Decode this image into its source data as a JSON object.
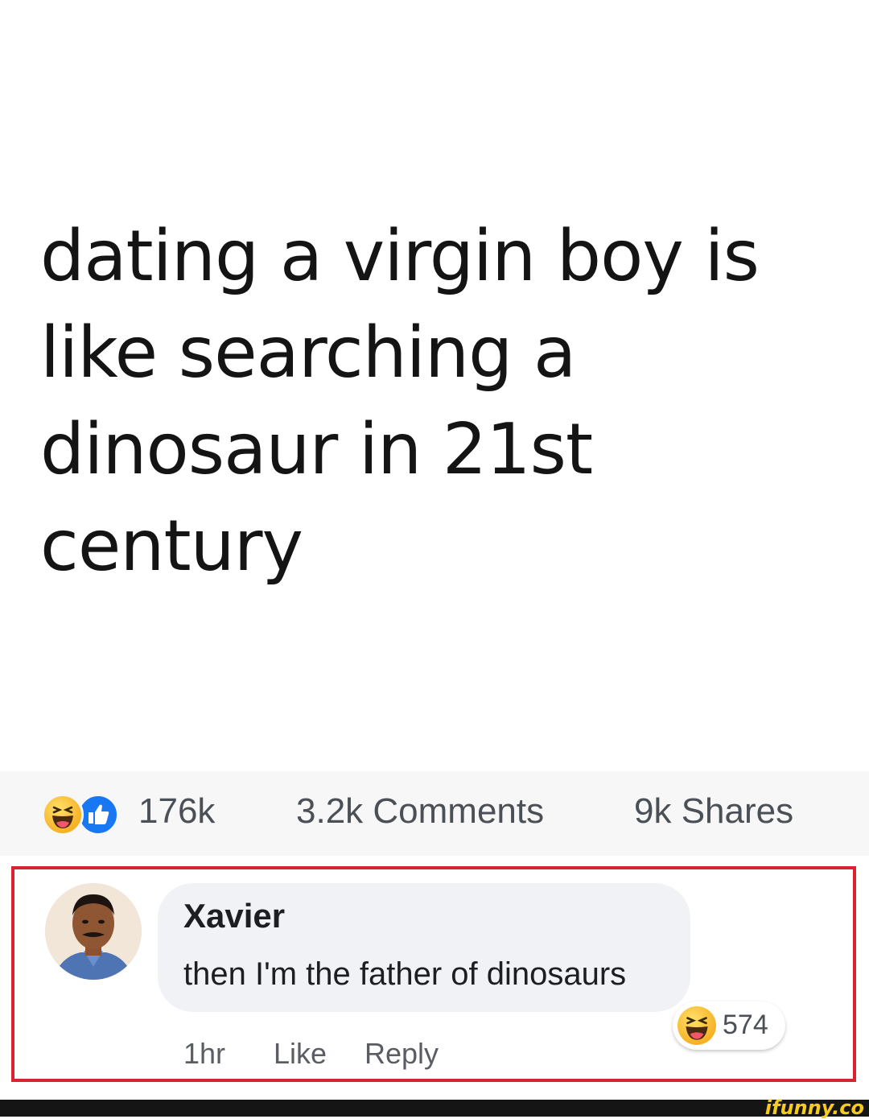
{
  "post": {
    "text": "dating a virgin boy is like searching a dinosaur in 21st century"
  },
  "stats": {
    "reaction_icons": [
      "haha-icon",
      "like-icon"
    ],
    "reactions_count": "176k",
    "comments_label": "3.2k Comments",
    "shares_label": "9k Shares"
  },
  "comment": {
    "author": "Xavier",
    "text": "then I'm the father of dinosaurs",
    "time": "1hr",
    "like_label": "Like",
    "reply_label": "Reply",
    "reaction_icon": "haha-icon",
    "reaction_count": "574"
  },
  "colors": {
    "highlight_border": "#d9232e",
    "like_blue": "#1877f2",
    "haha_yellow": "#f7b125",
    "watermark_yellow": "#f6cb1c"
  },
  "watermark": {
    "text": "ifunny.co"
  }
}
